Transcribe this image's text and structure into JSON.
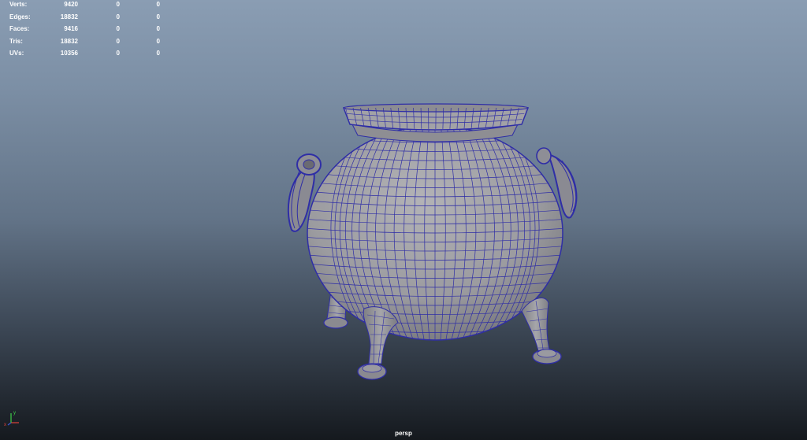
{
  "hud": {
    "rows": [
      {
        "label": "Verts:",
        "v1": "9420",
        "v2": "0",
        "v3": "0"
      },
      {
        "label": "Edges:",
        "v1": "18832",
        "v2": "0",
        "v3": "0"
      },
      {
        "label": "Faces:",
        "v1": "9416",
        "v2": "0",
        "v3": "0"
      },
      {
        "label": "Tris:",
        "v1": "18832",
        "v2": "0",
        "v3": "0"
      },
      {
        "label": "UVs:",
        "v1": "10356",
        "v2": "0",
        "v3": "0"
      }
    ]
  },
  "camera": "persp",
  "axis": {
    "x_label": "x",
    "y_label": "y"
  },
  "colors": {
    "wire": "#2f2ea6",
    "body": "#9a9a9e",
    "axis_x": "#e0413b",
    "axis_y": "#3fd04a",
    "axis_z": "#3a5bd6"
  }
}
